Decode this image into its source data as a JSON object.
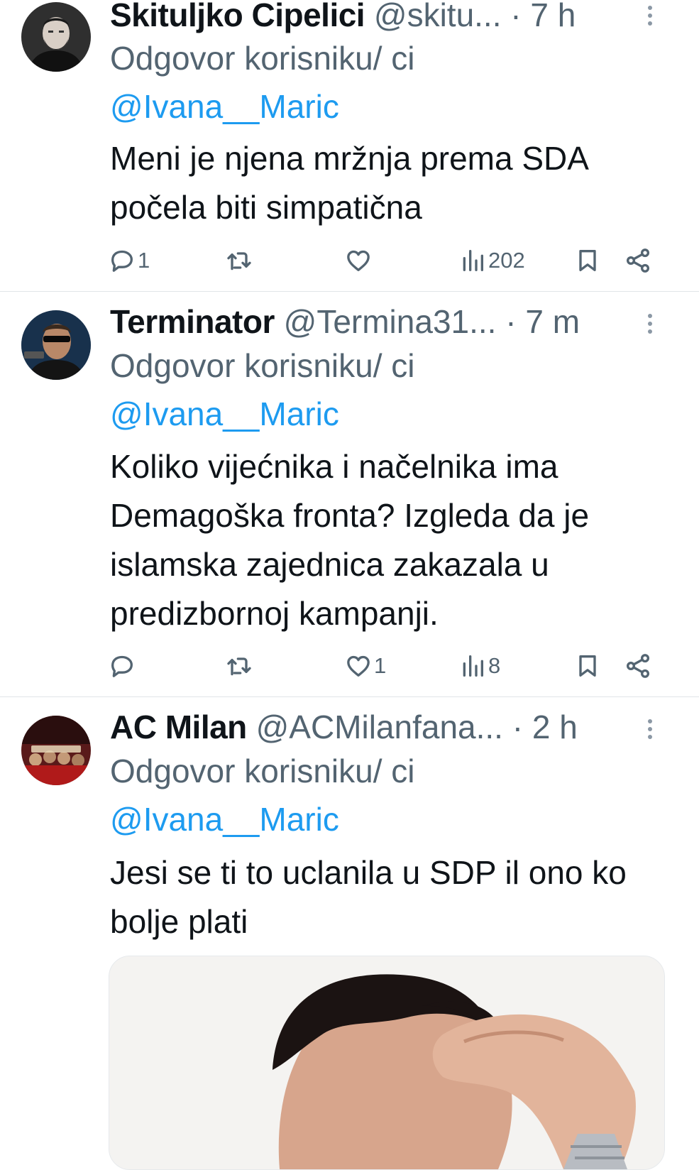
{
  "tweets": [
    {
      "name": "Skituljko Cipelici",
      "handle": "@skitu...",
      "separator": "·",
      "time": "7 h",
      "reply_prefix": "Odgovor korisniku/ ci ",
      "reply_mention": "@Ivana__Maric",
      "text": "Meni je njena mržnja prema SDA počela biti simpatična",
      "replies": "1",
      "retweets": "",
      "likes": "",
      "views": "202"
    },
    {
      "name": "Terminator",
      "handle": "@Termina31...",
      "separator": "·",
      "time": "7 m",
      "reply_prefix": "Odgovor korisniku/ ci ",
      "reply_mention": "@Ivana__Maric",
      "text": "Koliko vijećnika i načelnika ima Demagoška fronta? Izgleda da je islamska zajednica zakazala u predizbornoj kampanji.",
      "replies": "",
      "retweets": "",
      "likes": "1",
      "views": "8"
    },
    {
      "name": "AC Milan",
      "handle": "@ACMilanfana...",
      "separator": "·",
      "time": "2 h",
      "reply_prefix": "Odgovor korisniku/ ci ",
      "reply_mention": "@Ivana__Maric",
      "text": "Jesi se ti to uclanila u SDP il ono ko bolje plati"
    }
  ],
  "icons": {
    "reply": "reply-icon",
    "retweet": "retweet-icon",
    "like": "heart-icon",
    "views": "views-icon",
    "bookmark": "bookmark-icon",
    "share": "share-icon",
    "more": "more-vertical-icon"
  },
  "colors": {
    "mention": "#1d9bf0",
    "secondary_text": "#536471",
    "primary_text": "#0f1419",
    "divider": "#e1e5e8"
  }
}
